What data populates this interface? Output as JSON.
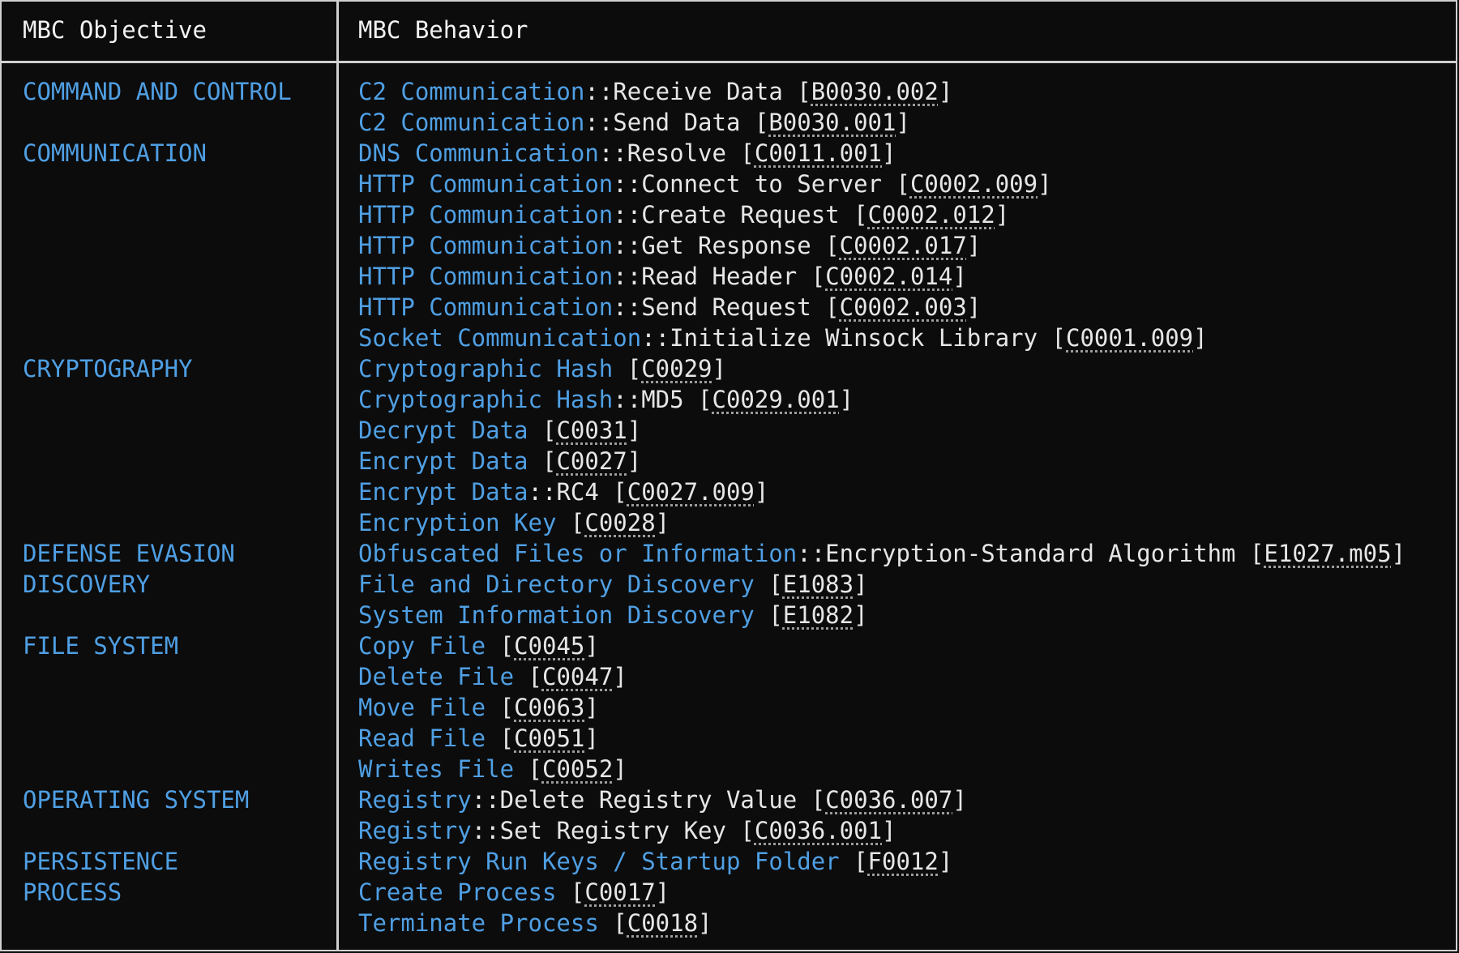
{
  "table": {
    "headers": {
      "objective": "MBC Objective",
      "behavior": "MBC Behavior"
    },
    "rows": [
      {
        "objective": "COMMAND AND CONTROL",
        "name": "C2 Communication",
        "sub": "Receive Data",
        "id": "B0030.002"
      },
      {
        "objective": "",
        "name": "C2 Communication",
        "sub": "Send Data",
        "id": "B0030.001"
      },
      {
        "objective": "COMMUNICATION",
        "name": "DNS Communication",
        "sub": "Resolve",
        "id": "C0011.001"
      },
      {
        "objective": "",
        "name": "HTTP Communication",
        "sub": "Connect to Server",
        "id": "C0002.009"
      },
      {
        "objective": "",
        "name": "HTTP Communication",
        "sub": "Create Request",
        "id": "C0002.012"
      },
      {
        "objective": "",
        "name": "HTTP Communication",
        "sub": "Get Response",
        "id": "C0002.017"
      },
      {
        "objective": "",
        "name": "HTTP Communication",
        "sub": "Read Header",
        "id": "C0002.014"
      },
      {
        "objective": "",
        "name": "HTTP Communication",
        "sub": "Send Request",
        "id": "C0002.003"
      },
      {
        "objective": "",
        "name": "Socket Communication",
        "sub": "Initialize Winsock Library",
        "id": "C0001.009"
      },
      {
        "objective": "CRYPTOGRAPHY",
        "name": "Cryptographic Hash",
        "sub": "",
        "id": "C0029"
      },
      {
        "objective": "",
        "name": "Cryptographic Hash",
        "sub": "MD5",
        "id": "C0029.001"
      },
      {
        "objective": "",
        "name": "Decrypt Data",
        "sub": "",
        "id": "C0031"
      },
      {
        "objective": "",
        "name": "Encrypt Data",
        "sub": "",
        "id": "C0027"
      },
      {
        "objective": "",
        "name": "Encrypt Data",
        "sub": "RC4",
        "id": "C0027.009"
      },
      {
        "objective": "",
        "name": "Encryption Key",
        "sub": "",
        "id": "C0028"
      },
      {
        "objective": "DEFENSE EVASION",
        "name": "Obfuscated Files or Information",
        "sub": "Encryption-Standard Algorithm",
        "id": "E1027.m05"
      },
      {
        "objective": "DISCOVERY",
        "name": "File and Directory Discovery",
        "sub": "",
        "id": "E1083"
      },
      {
        "objective": "",
        "name": "System Information Discovery",
        "sub": "",
        "id": "E1082"
      },
      {
        "objective": "FILE SYSTEM",
        "name": "Copy File",
        "sub": "",
        "id": "C0045"
      },
      {
        "objective": "",
        "name": "Delete File",
        "sub": "",
        "id": "C0047"
      },
      {
        "objective": "",
        "name": "Move File",
        "sub": "",
        "id": "C0063"
      },
      {
        "objective": "",
        "name": "Read File",
        "sub": "",
        "id": "C0051"
      },
      {
        "objective": "",
        "name": "Writes File",
        "sub": "",
        "id": "C0052"
      },
      {
        "objective": "OPERATING SYSTEM",
        "name": "Registry",
        "sub": "Delete Registry Value",
        "id": "C0036.007"
      },
      {
        "objective": "",
        "name": "Registry",
        "sub": "Set Registry Key",
        "id": "C0036.001"
      },
      {
        "objective": "PERSISTENCE",
        "name": "Registry Run Keys / Startup Folder",
        "sub": "",
        "id": "F0012"
      },
      {
        "objective": "PROCESS",
        "name": "Create Process",
        "sub": "",
        "id": "C0017"
      },
      {
        "objective": "",
        "name": "Terminate Process",
        "sub": "",
        "id": "C0018"
      }
    ]
  },
  "colors": {
    "background": "#0c0c0c",
    "accent_blue": "#4f9fe3",
    "text": "#e6e6e6",
    "border": "#d0d0d0"
  }
}
